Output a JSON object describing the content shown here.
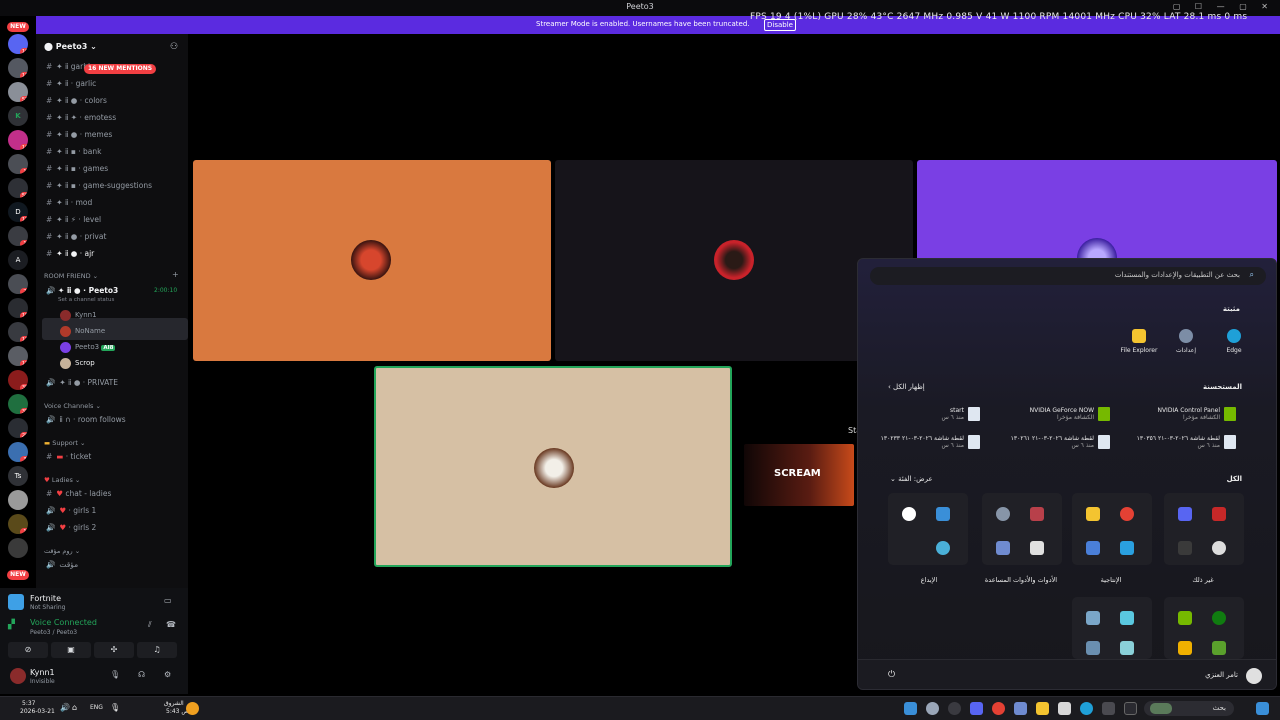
{
  "window": {
    "title": "Peeto3"
  },
  "streamer_banner": {
    "message": "Streamer Mode is enabled. Usernames have been truncated.",
    "button": "Disable"
  },
  "perf_overlay": "FPS 19 4 (1%L) GPU 28% 43°C 2647 MHz 0.985 V 41 W 1100 RPM 14001 MHz CPU 32% LAT 28.1 ms 0 ms",
  "server_rail": {
    "new_label": "NEW",
    "badges": [
      "16",
      "11",
      "52",
      "16",
      "1",
      "50",
      "17",
      "1",
      "2",
      "18",
      "13",
      "17",
      "39",
      "35",
      "20",
      "3",
      "1"
    ]
  },
  "server": {
    "name": "Peeto3"
  },
  "mentions_pill": "16 NEW MENTIONS",
  "channels": [
    {
      "name": "garbic"
    },
    {
      "name": "garlic"
    },
    {
      "name": "colors"
    },
    {
      "name": "emotess"
    },
    {
      "name": "memes"
    },
    {
      "name": "bank"
    },
    {
      "name": "games"
    },
    {
      "name": "game-suggestions"
    },
    {
      "name": "mod"
    },
    {
      "name": "level"
    },
    {
      "name": "privat"
    },
    {
      "name": "ajr"
    }
  ],
  "room_friend": {
    "category": "ROOM FRIEND",
    "voice_channel": "Peeto3",
    "timer": "2:00:10",
    "status_hint": "Set a channel status",
    "users": [
      {
        "name": "Kynn1"
      },
      {
        "name": "NoName"
      },
      {
        "name": "Peeto3",
        "tag": "AI8"
      },
      {
        "name": "Scrop"
      }
    ],
    "private_channel": "PRIVATE"
  },
  "voice_channels": {
    "category": "Voice Channels",
    "items": [
      "room follows"
    ]
  },
  "support": {
    "category": "Support",
    "items": [
      "ticket"
    ]
  },
  "ladies": {
    "category": "Ladies",
    "items": [
      "chat - ladies",
      "girls 1",
      "girls 2"
    ]
  },
  "last_section": {
    "category": "روم مؤقت",
    "items": [
      "مؤقت"
    ]
  },
  "activity": {
    "game": "Fortnite",
    "state": "Not Sharing"
  },
  "voice_status": {
    "title": "Voice Connected",
    "channel": "Peeto3 / Peeto3"
  },
  "user": {
    "name": "Kynn1",
    "status": "Invisible"
  },
  "stream_label": "Sta",
  "thumbnail_title": "SCREAM",
  "start_menu": {
    "search_placeholder": "بحث عن التطبيقات والإعدادات والمستندات",
    "pinned_title": "مثبتة",
    "pinned": [
      {
        "label": "Edge",
        "icon": "edge-icon"
      },
      {
        "label": "إعدادات",
        "icon": "settings-icon"
      },
      {
        "label": "File Explorer",
        "icon": "folder-icon"
      }
    ],
    "recommended_title": "المستحسنة",
    "show_all": "إظهار الكل",
    "recommended": [
      {
        "title": "NVIDIA Control Panel",
        "sub": "الكشافة مؤخرا"
      },
      {
        "title": "NVIDIA GeForce NOW",
        "sub": "الكشافة مؤخرا"
      },
      {
        "title": "start",
        "sub": "منذ ٦ س"
      },
      {
        "title": "لقطة شاشة ٢٠٢٦-٠٣-٢١ ١٣٠٣٥٦",
        "sub": "منذ ٦ س"
      },
      {
        "title": "لقطة شاشة ٢٠٢٦-٠٣-٢١ ١٣٠٢٦١",
        "sub": "منذ ٦ س"
      },
      {
        "title": "لقطة شاشة ٢٠٢٦-٠٣-٢١ ١٣٠٢٣٣",
        "sub": "منذ ٦ س"
      }
    ],
    "all_title": "الكل",
    "view_label": "عرض: الفئة",
    "categories": [
      "غير ذلك",
      "الإنتاجية",
      "الأدوات والأدوات المساعدة",
      "الإبداع"
    ],
    "user_name": "تامر العنزي"
  },
  "taskbar": {
    "time": "5:37",
    "date": "2026-03-21",
    "lang": "ENG",
    "weather_place": "الشروق",
    "weather_time": "5:43 ص",
    "search_label": "بحث"
  },
  "colors": {
    "accent": "#5b2be0",
    "discord_bg": "#0e0e10",
    "voice_green": "#23a55a",
    "mention_red": "#f23f43",
    "tile_orange": "#d9793f",
    "tile_purple": "#7a3fe4",
    "tile_beige": "#d6c0a4",
    "tile_dark": "#16141a"
  }
}
